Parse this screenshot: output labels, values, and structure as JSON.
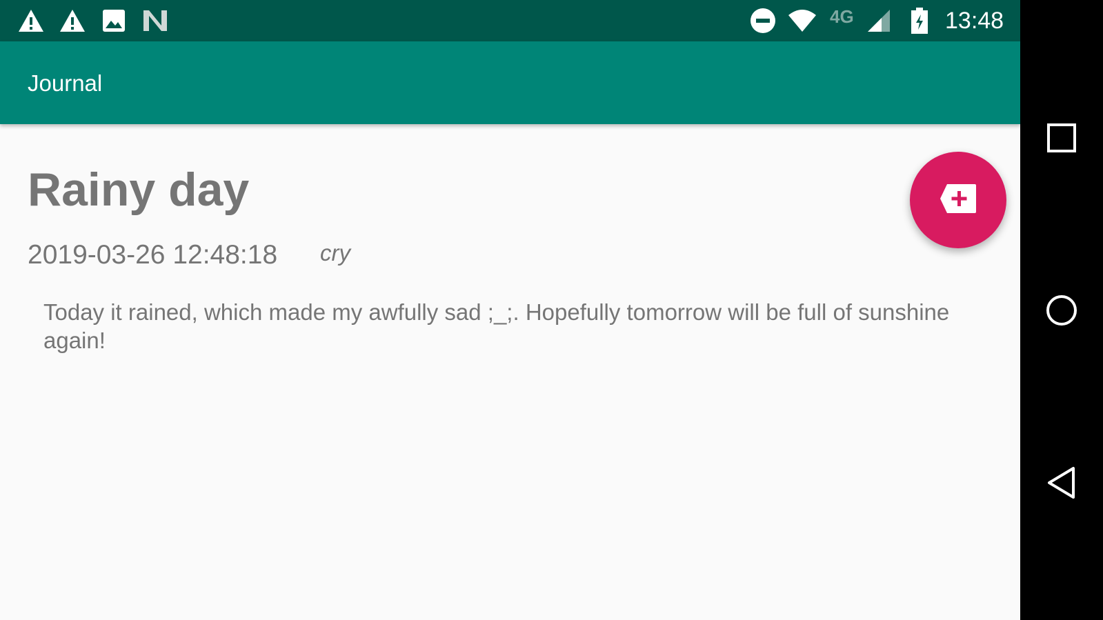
{
  "status_bar": {
    "time": "13:48",
    "network": "4G",
    "icons": [
      "warning-icon",
      "warning-icon",
      "image-icon",
      "n-icon",
      "do-not-disturb-icon",
      "wifi-icon",
      "signal-icon",
      "battery-charging-icon"
    ]
  },
  "app_bar": {
    "title": "Journal"
  },
  "entry": {
    "title": "Rainy day",
    "datetime": "2019-03-26 12:48:18",
    "mood": "cry",
    "body": "Today it rained, which made my awfully sad ;_;. Hopefully tomorrow will be full of sunshine again!"
  },
  "fab": {
    "icon": "new-label-icon",
    "color": "#d81b60"
  },
  "colors": {
    "primary": "#008577",
    "primary_dark": "#00574b",
    "accent": "#d81b60"
  },
  "nav_bar": {
    "buttons": [
      "recents",
      "home",
      "back"
    ]
  }
}
